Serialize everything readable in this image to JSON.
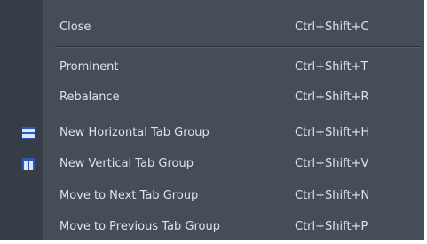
{
  "menu": {
    "top_items": [
      {
        "label": "Close",
        "shortcut": "Ctrl+Shift+C"
      }
    ],
    "items": [
      {
        "label": "Prominent",
        "shortcut": "Ctrl+Shift+T"
      },
      {
        "label": "Rebalance",
        "shortcut": "Ctrl+Shift+R"
      },
      {
        "label": "New Horizontal Tab Group",
        "shortcut": "Ctrl+Shift+H",
        "icon": "horizontal-split-icon"
      },
      {
        "label": "New Vertical Tab Group",
        "shortcut": "Ctrl+Shift+V",
        "icon": "vertical-split-icon"
      },
      {
        "label": "Move to Next Tab Group",
        "shortcut": "Ctrl+Shift+N"
      },
      {
        "label": "Move to Previous Tab Group",
        "shortcut": "Ctrl+Shift+P"
      }
    ]
  },
  "colors": {
    "menu_background": "#444d58",
    "gutter_background": "#363d46",
    "text": "#dfe3e8",
    "icon_fill": "#d7e6f7",
    "icon_accent": "#2d58b4"
  }
}
